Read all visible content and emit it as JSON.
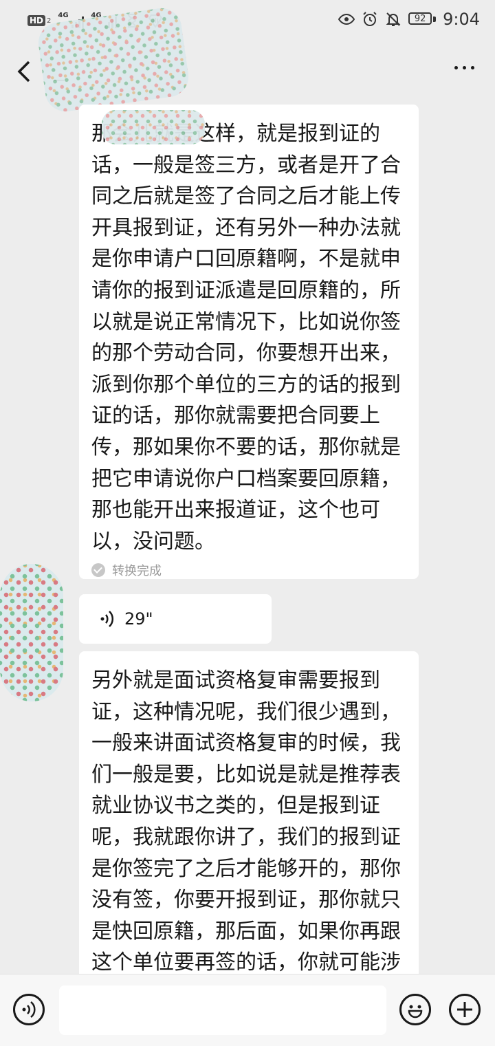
{
  "status_bar": {
    "hd_label": "HD",
    "hd_sim": "2",
    "network_1": "4G",
    "network_2": "4G",
    "battery": "92",
    "time": "9:04"
  },
  "header": {
    "title": "_"
  },
  "messages": {
    "msg1_text": "那会儿就是这样，就是报到证的话，一般是签三方，或者是开了合同之后就是签了合同之后才能上传开具报到证，还有另外一种办法就是你申请户口回原籍啊，不是就申请你的报到证派遣是回原籍的，所以就是说正常情况下，比如说你签的那个劳动合同，你要想开出来，派到你那个单位的三方的话的报到证的话，那你就需要把合同要上传，那如果你不要的话，那你就是把它申请说你户口档案要回原籍，那也能开出来报道证，这个也可以，没问题。",
    "msg1_status": "转换完成",
    "voice_length": "29\"",
    "msg2_text": "另外就是面试资格复审需要报到证，这种情况呢，我们很少遇到，一般来讲面试资格复审的时候，我们一般是要，比如说是就是推荐表就业协议书之类的，但是报到证呢，我就跟你讲了，我们的报到证是你签完了之后才能够开的，那你没有签，你要开报到证，那你就只是快回原籍，那后面，如果你再跟这个单位要再签的话，你就可能涉及到百派"
  },
  "input": {
    "value": ""
  },
  "icons": [
    "back-icon",
    "more-icon",
    "voice-mode-icon",
    "emoji-icon",
    "plus-icon",
    "check-icon",
    "voice-wave-icon"
  ]
}
